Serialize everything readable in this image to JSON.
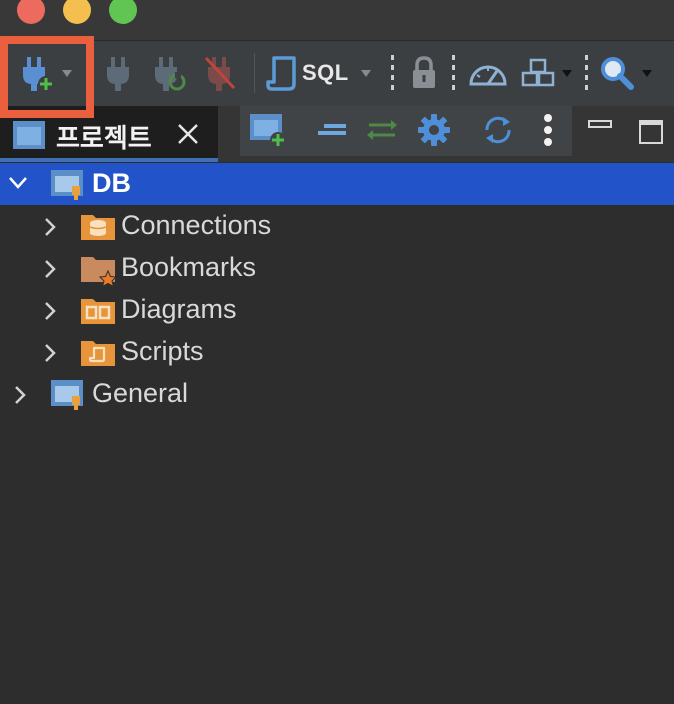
{
  "window": {
    "traffic_lights": {
      "close": "#ed6a5e",
      "minimize": "#f5bf4f",
      "zoom": "#61c554"
    }
  },
  "toolbar": {
    "new_connection_icon": "plug-plus-icon",
    "connect_icon": "plug-icon",
    "reconnect_icon": "plug-refresh-icon",
    "disconnect_icon": "plug-disconnect-icon",
    "sql_label": "SQL",
    "transaction_icon": "lock-icon",
    "dashboard_icon": "speedometer-icon",
    "tasks_icon": "boxes-icon",
    "search_icon": "search-icon",
    "highlight_color": "#ea5f3d"
  },
  "tab": {
    "label": "프로젝트",
    "close_icon": "close-icon"
  },
  "view_toolbar": {
    "icons": [
      "new-project-icon",
      "collapse-icon",
      "link-editor-icon",
      "settings-icon",
      "refresh-icon",
      "more-icon"
    ]
  },
  "tree": {
    "selected_color": "#2353c8",
    "items": [
      {
        "label": "DB",
        "icon": "project-icon",
        "expanded": true
      },
      {
        "label": "Connections",
        "icon": "database-folder-icon"
      },
      {
        "label": "Bookmarks",
        "icon": "bookmark-folder-icon"
      },
      {
        "label": "Diagrams",
        "icon": "diagram-folder-icon"
      },
      {
        "label": "Scripts",
        "icon": "script-folder-icon"
      },
      {
        "label": "General",
        "icon": "project-icon",
        "expanded": false
      }
    ]
  }
}
